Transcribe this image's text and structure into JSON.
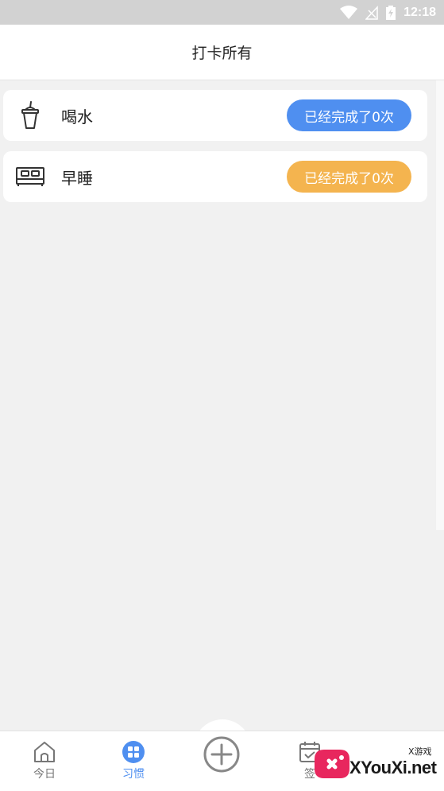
{
  "status_bar": {
    "time": "12:18",
    "icons": [
      "wifi-icon",
      "signal-icon",
      "battery-icon"
    ]
  },
  "header": {
    "title": "打卡所有"
  },
  "habits": [
    {
      "name": "喝水",
      "icon": "cup-icon",
      "badge": "已经完成了0次",
      "badge_color": "#4f8ff0"
    },
    {
      "name": "早睡",
      "icon": "bed-icon",
      "badge": "已经完成了0次",
      "badge_color": "#f4b44f"
    }
  ],
  "tab_bar": {
    "tabs": [
      {
        "label": "今日",
        "icon": "home-icon",
        "active": false
      },
      {
        "label": "习惯",
        "icon": "grid-icon",
        "active": true
      },
      {
        "label": "",
        "icon": "add-circle-icon",
        "active": false
      },
      {
        "label": "签",
        "icon": "calendar-check-icon",
        "active": false
      }
    ]
  },
  "watermark": {
    "text": "XYouXi.net",
    "small": "X游戏"
  },
  "colors": {
    "accent": "#4f8ff0",
    "orange": "#f4b44f",
    "background": "#f1f1f1"
  }
}
